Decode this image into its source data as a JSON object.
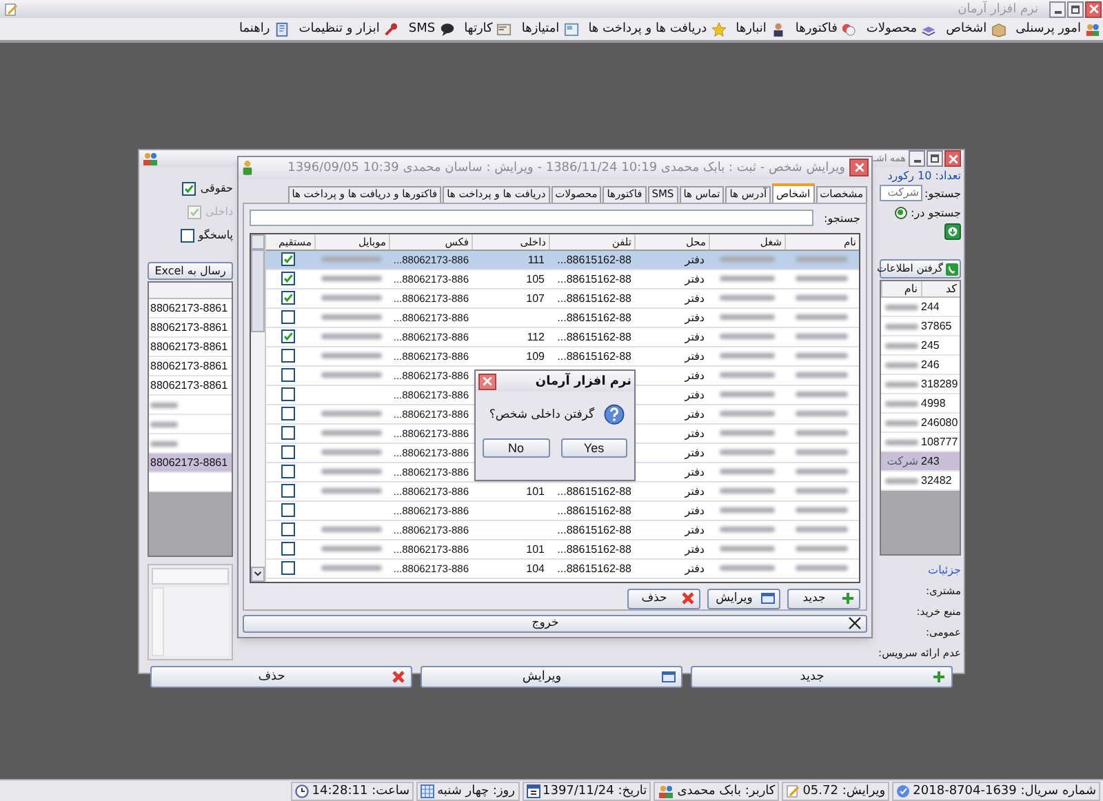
{
  "app_window": {
    "title": "نرم افزار آرمان"
  },
  "menu": [
    {
      "label": "امور پرسنلی"
    },
    {
      "label": "اشخاص"
    },
    {
      "label": "محصولات"
    },
    {
      "label": "فاکتورها"
    },
    {
      "label": "انبارها"
    },
    {
      "label": "دریافت ها و پرداخت ها"
    },
    {
      "label": "امتیازها"
    },
    {
      "label": "کارتها"
    },
    {
      "label": "SMS"
    },
    {
      "label": "ابزار و تنظیمات"
    },
    {
      "label": "راهنما"
    }
  ],
  "list_window": {
    "title": "همه اشـ",
    "record_count": "تعداد: 10 رکورد",
    "search_label": "جستجو:",
    "search_value": "شرکت",
    "search_in_label": "جستجو در:",
    "search_in_option": {
      "selected": true
    },
    "fetch_button": "گرفتن اطلاعات",
    "excel_button": "رسال به Excel",
    "filters": [
      {
        "label": "حقوقی",
        "checked": true,
        "disabled": false
      },
      {
        "label": "داخلی",
        "checked": true,
        "disabled": true
      },
      {
        "label": "پاسخگو",
        "checked": false,
        "disabled": false
      }
    ],
    "columns": [
      "کد",
      "نام"
    ],
    "rows": [
      {
        "code": "244",
        "name": "",
        "phone": "88062173-8861",
        "phone_blurred": false,
        "selected": false
      },
      {
        "code": "37865",
        "name": "",
        "phone": "88062173-8861",
        "phone_blurred": false,
        "selected": false
      },
      {
        "code": "245",
        "name": "",
        "phone": "88062173-8861",
        "phone_blurred": false,
        "selected": false
      },
      {
        "code": "246",
        "name": "",
        "phone": "88062173-8861",
        "phone_blurred": false,
        "selected": false
      },
      {
        "code": "318289",
        "name": "",
        "phone": "88062173-8861",
        "phone_blurred": false,
        "selected": false
      },
      {
        "code": "4998",
        "name": "",
        "phone": "",
        "phone_blurred": true,
        "selected": false
      },
      {
        "code": "246080",
        "name": "",
        "phone": "",
        "phone_blurred": true,
        "selected": false
      },
      {
        "code": "108777",
        "name": "",
        "phone": "",
        "phone_blurred": true,
        "selected": false
      },
      {
        "code": "243",
        "name": "شرکت",
        "phone": "88062173-8861",
        "phone_blurred": false,
        "selected": true
      },
      {
        "code": "32482",
        "name": "",
        "phone": "",
        "phone_blurred": false,
        "selected": false
      }
    ],
    "details_title": "جزئیات",
    "detail_labels": [
      "مشتری:",
      "منبع خرید:",
      "عمومی:",
      "عدم ارائه سرویس:"
    ],
    "buttons": [
      {
        "label": "جدید",
        "kind": "add"
      },
      {
        "label": "ویرایش",
        "kind": "edit"
      },
      {
        "label": "حذف",
        "kind": "delete"
      }
    ]
  },
  "person_window": {
    "title": "ویرایش شخص - ثبت : بابک محمدی 10:19 1386/11/24 - ویرایش : ساسان محمدی 10:39 1396/09/05",
    "tabs": [
      {
        "label": "مشخصات",
        "selected": false
      },
      {
        "label": "اشخاص",
        "selected": true
      },
      {
        "label": "آدرس ها",
        "selected": false
      },
      {
        "label": "تماس ها",
        "selected": false
      },
      {
        "label": "SMS",
        "selected": false
      },
      {
        "label": "فاکتورها",
        "selected": false
      },
      {
        "label": "محصولات",
        "selected": false
      },
      {
        "label": "دریافت ها و پرداخت ها",
        "selected": false
      },
      {
        "label": "فاکتورها و دریافت ها و پرداخت ها",
        "selected": false
      }
    ],
    "search_label": "جستجو:",
    "columns": [
      "نام",
      "شغل",
      "محل",
      "تلفن",
      "داخلی",
      "فکس",
      "موبایل",
      "مستقیم"
    ],
    "rows": [
      {
        "place": "دفتر",
        "phone": "...88615162-88",
        "extension": "111",
        "fax": "...88062173-886",
        "mobile_blurred": true,
        "direct": true,
        "selected": true
      },
      {
        "place": "دفتر",
        "phone": "...88615162-88",
        "extension": "105",
        "fax": "...88062173-886",
        "mobile_blurred": true,
        "direct": true,
        "selected": false
      },
      {
        "place": "دفتر",
        "phone": "...88615162-88",
        "extension": "107",
        "fax": "...88062173-886",
        "mobile_blurred": true,
        "direct": true,
        "selected": false
      },
      {
        "place": "دفتر",
        "phone": "...88615162-88",
        "extension": "",
        "fax": "...88062173-886",
        "mobile_blurred": true,
        "direct": false,
        "selected": false
      },
      {
        "place": "دفتر",
        "phone": "...88615162-88",
        "extension": "112",
        "fax": "...88062173-886",
        "mobile_blurred": true,
        "direct": true,
        "selected": false
      },
      {
        "place": "دفتر",
        "phone": "...88615162-88",
        "extension": "109",
        "fax": "...88062173-886",
        "mobile_blurred": true,
        "direct": false,
        "selected": false
      },
      {
        "place": "دفتر",
        "phone": "",
        "extension": "",
        "fax": "...88062173-886",
        "mobile_blurred": true,
        "direct": false,
        "selected": false
      },
      {
        "place": "دفتر",
        "phone": "",
        "extension": "",
        "fax": "...88062173-886",
        "mobile_blurred": false,
        "direct": false,
        "selected": false
      },
      {
        "place": "دفتر",
        "phone": "",
        "extension": "",
        "fax": "...88062173-886",
        "mobile_blurred": true,
        "direct": false,
        "selected": false
      },
      {
        "place": "دفتر",
        "phone": "",
        "extension": "",
        "fax": "...88062173-886",
        "mobile_blurred": true,
        "direct": false,
        "selected": false
      },
      {
        "place": "دفتر",
        "phone": "",
        "extension": "",
        "fax": "...88062173-886",
        "mobile_blurred": true,
        "direct": false,
        "selected": false
      },
      {
        "place": "دفتر",
        "phone": "",
        "extension": "",
        "fax": "...88062173-886",
        "mobile_blurred": true,
        "direct": false,
        "selected": false
      },
      {
        "place": "دفتر",
        "phone": "...88615162-88",
        "extension": "101",
        "fax": "...88062173-886",
        "mobile_blurred": true,
        "direct": false,
        "selected": false
      },
      {
        "place": "دفتر",
        "phone": "...88615162-88",
        "extension": "",
        "fax": "...88062173-886",
        "mobile_blurred": false,
        "direct": false,
        "selected": false
      },
      {
        "place": "دفتر",
        "phone": "...88615162-88",
        "extension": "",
        "fax": "...88062173-886",
        "mobile_blurred": true,
        "direct": false,
        "selected": false
      },
      {
        "place": "دفتر",
        "phone": "...88615162-88",
        "extension": "101",
        "fax": "...88062173-886",
        "mobile_blurred": true,
        "direct": false,
        "selected": false
      },
      {
        "place": "دفتر",
        "phone": "...88615162-88",
        "extension": "104",
        "fax": "...88062173-886",
        "mobile_blurred": true,
        "direct": false,
        "selected": false
      }
    ],
    "buttons": [
      {
        "label": "جدید",
        "kind": "add"
      },
      {
        "label": "ویرایش",
        "kind": "edit"
      },
      {
        "label": "حذف",
        "kind": "delete"
      }
    ],
    "exit_button": "خروج"
  },
  "dialog": {
    "title": "نرم افزار آرمان",
    "message": "گرفتن داخلی شخص؟",
    "buttons": [
      "Yes",
      "No"
    ]
  },
  "status_bar": [
    {
      "label": "شماره سریال: 1639-8704-2018"
    },
    {
      "label": "ویرایش: 05.72"
    },
    {
      "label": "کاربر: بابک محمدی"
    },
    {
      "label": "تاریخ: 1397/11/24"
    },
    {
      "label": "روز: چهار شنبه"
    },
    {
      "label": "ساعت: 14:28:11"
    }
  ]
}
